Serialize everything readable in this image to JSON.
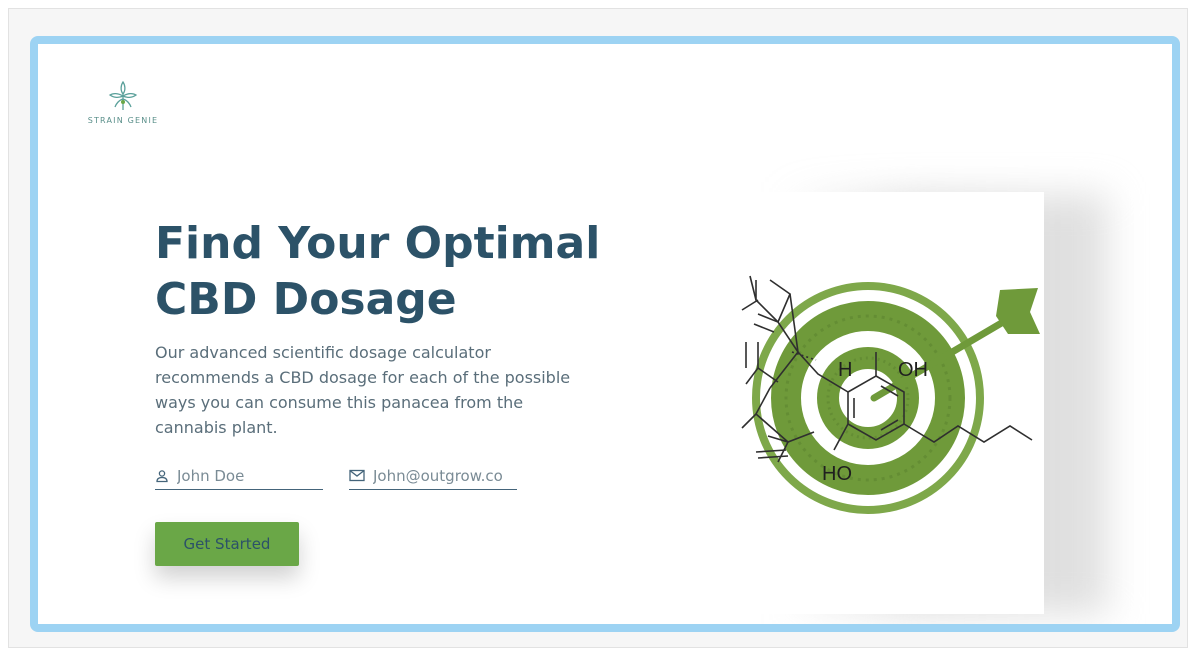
{
  "brand": {
    "name": "STRAIN GENIE",
    "logo_icon": "cannabis-leaf-icon",
    "accent_color": "#6aa747",
    "frame_color": "#9dd3f3",
    "heading_color": "#2c5268"
  },
  "hero": {
    "headline": "Find Your Optimal CBD Dosage",
    "description": "Our advanced scientific dosage calculator recommends a CBD dosage for each of the possible ways you can consume this panacea from the cannabis plant."
  },
  "form": {
    "name_placeholder": "John Doe",
    "name_icon": "user-icon",
    "email_placeholder": "John@outgrow.co",
    "email_icon": "mail-icon",
    "submit_label": "Get Started"
  },
  "illustration": {
    "description_icon": "target-molecule-illustration",
    "labels": {
      "h": "H",
      "oh": "OH",
      "ho": "HO"
    }
  }
}
